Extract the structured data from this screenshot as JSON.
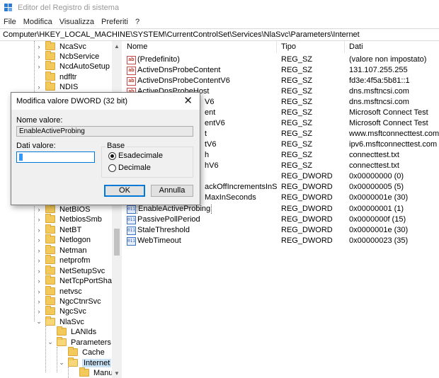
{
  "window": {
    "title": "Editor del Registro di sistema",
    "accent": "#0078d7"
  },
  "menu": {
    "items": [
      "File",
      "Modifica",
      "Visualizza",
      "Preferiti",
      "?"
    ]
  },
  "address": {
    "path": "Computer\\HKEY_LOCAL_MACHINE\\SYSTEM\\CurrentControlSet\\Services\\NlaSvc\\Parameters\\Internet"
  },
  "tree": {
    "items": [
      {
        "label": "NcaSvc",
        "chevron": ">"
      },
      {
        "label": "NcbService",
        "chevron": ">"
      },
      {
        "label": "NcdAutoSetup",
        "chevron": ">"
      },
      {
        "label": "ndfltr",
        "chevron": ""
      },
      {
        "label": "NDIS",
        "chevron": ">"
      },
      {
        "label": "NetBIOS",
        "chevron": ">"
      },
      {
        "label": "NetbiosSmb",
        "chevron": ">"
      },
      {
        "label": "NetBT",
        "chevron": ">"
      },
      {
        "label": "Netlogon",
        "chevron": ">"
      },
      {
        "label": "Netman",
        "chevron": ">"
      },
      {
        "label": "netprofm",
        "chevron": ">"
      },
      {
        "label": "NetSetupSvc",
        "chevron": ">"
      },
      {
        "label": "NetTcpPortSharing",
        "chevron": ">"
      },
      {
        "label": "netvsc",
        "chevron": ">"
      },
      {
        "label": "NgcCtnrSvc",
        "chevron": ">"
      },
      {
        "label": "NgcSvc",
        "chevron": ">"
      },
      {
        "label": "NlaSvc",
        "chevron": "v"
      },
      {
        "label": "LANIds",
        "chevron": ""
      },
      {
        "label": "Parameters",
        "chevron": "v"
      },
      {
        "label": "Cache",
        "chevron": ""
      },
      {
        "label": "Internet",
        "chevron": "v"
      },
      {
        "label": "ManualP",
        "chevron": ""
      }
    ]
  },
  "values": {
    "headers": {
      "name": "Nome",
      "type": "Tipo",
      "data": "Dati"
    },
    "rows": [
      {
        "name": "(Predefinito)",
        "type": "REG_SZ",
        "data": "(valore non impostato)",
        "icon": "string-value-icon"
      },
      {
        "name": "ActiveDnsProbeContent",
        "type": "REG_SZ",
        "data": "131.107.255.255",
        "icon": "string-value-icon"
      },
      {
        "name": "ActiveDnsProbeContentV6",
        "type": "REG_SZ",
        "data": "fd3e:4f5a:5b81::1",
        "icon": "string-value-icon"
      },
      {
        "name": "ActiveDnsProbeHost",
        "type": "REG_SZ",
        "data": "dns.msftncsi.com",
        "icon": "string-value-icon"
      },
      {
        "name": "V6",
        "type": "REG_SZ",
        "data": "dns.msftncsi.com",
        "icon": "string-value-icon"
      },
      {
        "name": "ent",
        "type": "REG_SZ",
        "data": "Microsoft Connect Test",
        "icon": "string-value-icon"
      },
      {
        "name": "entV6",
        "type": "REG_SZ",
        "data": "Microsoft Connect Test",
        "icon": "string-value-icon"
      },
      {
        "name": "t",
        "type": "REG_SZ",
        "data": "www.msftconnecttest.com",
        "icon": "string-value-icon"
      },
      {
        "name": "tV6",
        "type": "REG_SZ",
        "data": "ipv6.msftconnecttest.com",
        "icon": "string-value-icon"
      },
      {
        "name": "h",
        "type": "REG_SZ",
        "data": "connecttest.txt",
        "icon": "string-value-icon"
      },
      {
        "name": "hV6",
        "type": "REG_SZ",
        "data": "connecttest.txt",
        "icon": "string-value-icon"
      },
      {
        "name": "",
        "type": "REG_DWORD",
        "data": "0x00000000 (0)",
        "icon": ""
      },
      {
        "name": "ackOffIncrementsInSec...",
        "type": "REG_DWORD",
        "data": "0x00000005 (5)",
        "icon": ""
      },
      {
        "name": "MaxInSeconds",
        "type": "REG_DWORD",
        "data": "0x0000001e (30)",
        "icon": ""
      },
      {
        "name": "EnableActiveProbing",
        "type": "REG_DWORD",
        "data": "0x00000001 (1)",
        "icon": "binary-value-icon"
      },
      {
        "name": "PassivePollPeriod",
        "type": "REG_DWORD",
        "data": "0x0000000f (15)",
        "icon": "binary-value-icon"
      },
      {
        "name": "StaleThreshold",
        "type": "REG_DWORD",
        "data": "0x0000001e (30)",
        "icon": "binary-value-icon"
      },
      {
        "name": "WebTimeout",
        "type": "REG_DWORD",
        "data": "0x00000023 (35)",
        "icon": "binary-value-icon"
      }
    ]
  },
  "dialog": {
    "title": "Modifica valore DWORD (32 bit)",
    "close": "✕",
    "name_label": "Nome valore:",
    "name_value": "EnableActiveProbing",
    "data_label": "Dati valore:",
    "data_value": "1",
    "base_label": "Base",
    "radio_hex": "Esadecimale",
    "radio_dec": "Decimale",
    "radio_selected": "hex",
    "ok_label": "OK",
    "cancel_label": "Annulla"
  }
}
